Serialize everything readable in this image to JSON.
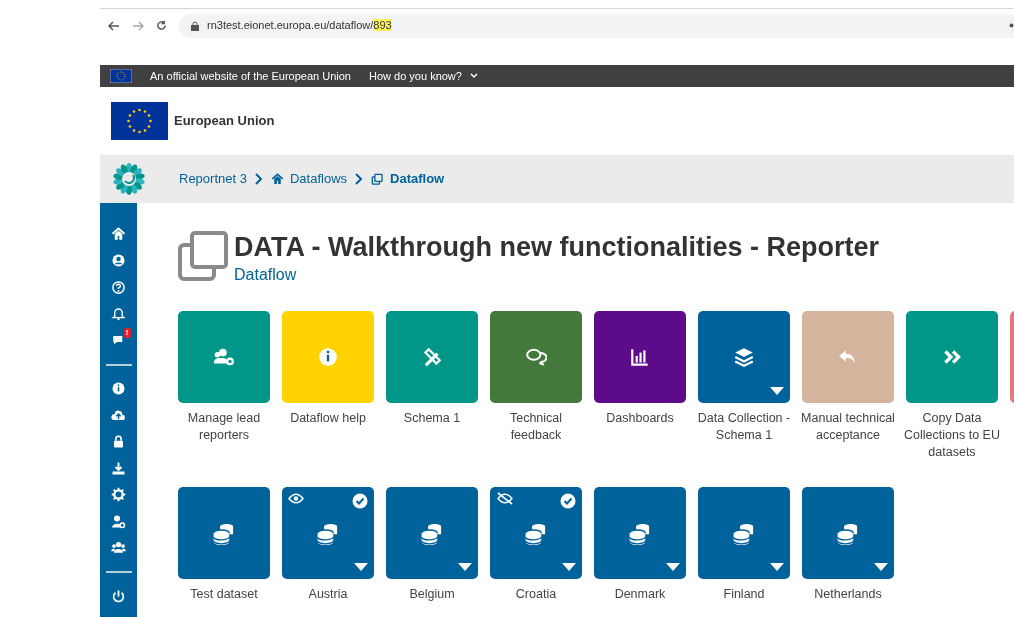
{
  "browser": {
    "url": "rn3test.eionet.europa.eu/dataflow/",
    "url_highlight": "893"
  },
  "eu_banner": {
    "text": "An official website of the European Union",
    "link": "How do you know?"
  },
  "header": {
    "title": "European Union"
  },
  "breadcrumbs": [
    {
      "label": "Reportnet 3",
      "current": false
    },
    {
      "label": "Dataflows",
      "current": false
    },
    {
      "label": "Dataflow",
      "current": true
    }
  ],
  "sidebar": {
    "badge": "!"
  },
  "page": {
    "title": "DATA - Walkthrough new functionalities - Reporter",
    "subtitle": "Dataflow"
  },
  "tiles": [
    {
      "label": "Manage lead reporters",
      "color": "#009688",
      "dropdown": false
    },
    {
      "label": "Dataflow help",
      "color": "#ffd200",
      "dropdown": false
    },
    {
      "label": "Schema 1",
      "color": "#009688",
      "dropdown": false
    },
    {
      "label": "Technical feedback",
      "color": "#437a3c",
      "dropdown": false
    },
    {
      "label": "Dashboards",
      "color": "#5c0b8a",
      "dropdown": false
    },
    {
      "label": "Data Collection - Schema 1",
      "color": "#00629b",
      "dropdown": true
    },
    {
      "label": "Manual technical acceptance",
      "color": "#d4b49c",
      "dropdown": false
    },
    {
      "label": "Copy Data Collections to EU datasets",
      "color": "#009688",
      "dropdown": false
    },
    {
      "color": "#e57a7e"
    }
  ],
  "datasets": [
    {
      "label": "Test dataset",
      "visible": false,
      "hidden": false,
      "checked": false,
      "dropdown": false
    },
    {
      "label": "Austria",
      "visible": true,
      "hidden": false,
      "checked": true,
      "dropdown": true
    },
    {
      "label": "Belgium",
      "visible": false,
      "hidden": false,
      "checked": false,
      "dropdown": true
    },
    {
      "label": "Croatia",
      "visible": false,
      "hidden": true,
      "checked": true,
      "dropdown": true
    },
    {
      "label": "Denmark",
      "visible": false,
      "hidden": false,
      "checked": false,
      "dropdown": true
    },
    {
      "label": "Finland",
      "visible": false,
      "hidden": false,
      "checked": false,
      "dropdown": true
    },
    {
      "label": "Netherlands",
      "visible": false,
      "hidden": false,
      "checked": false,
      "dropdown": true
    }
  ]
}
